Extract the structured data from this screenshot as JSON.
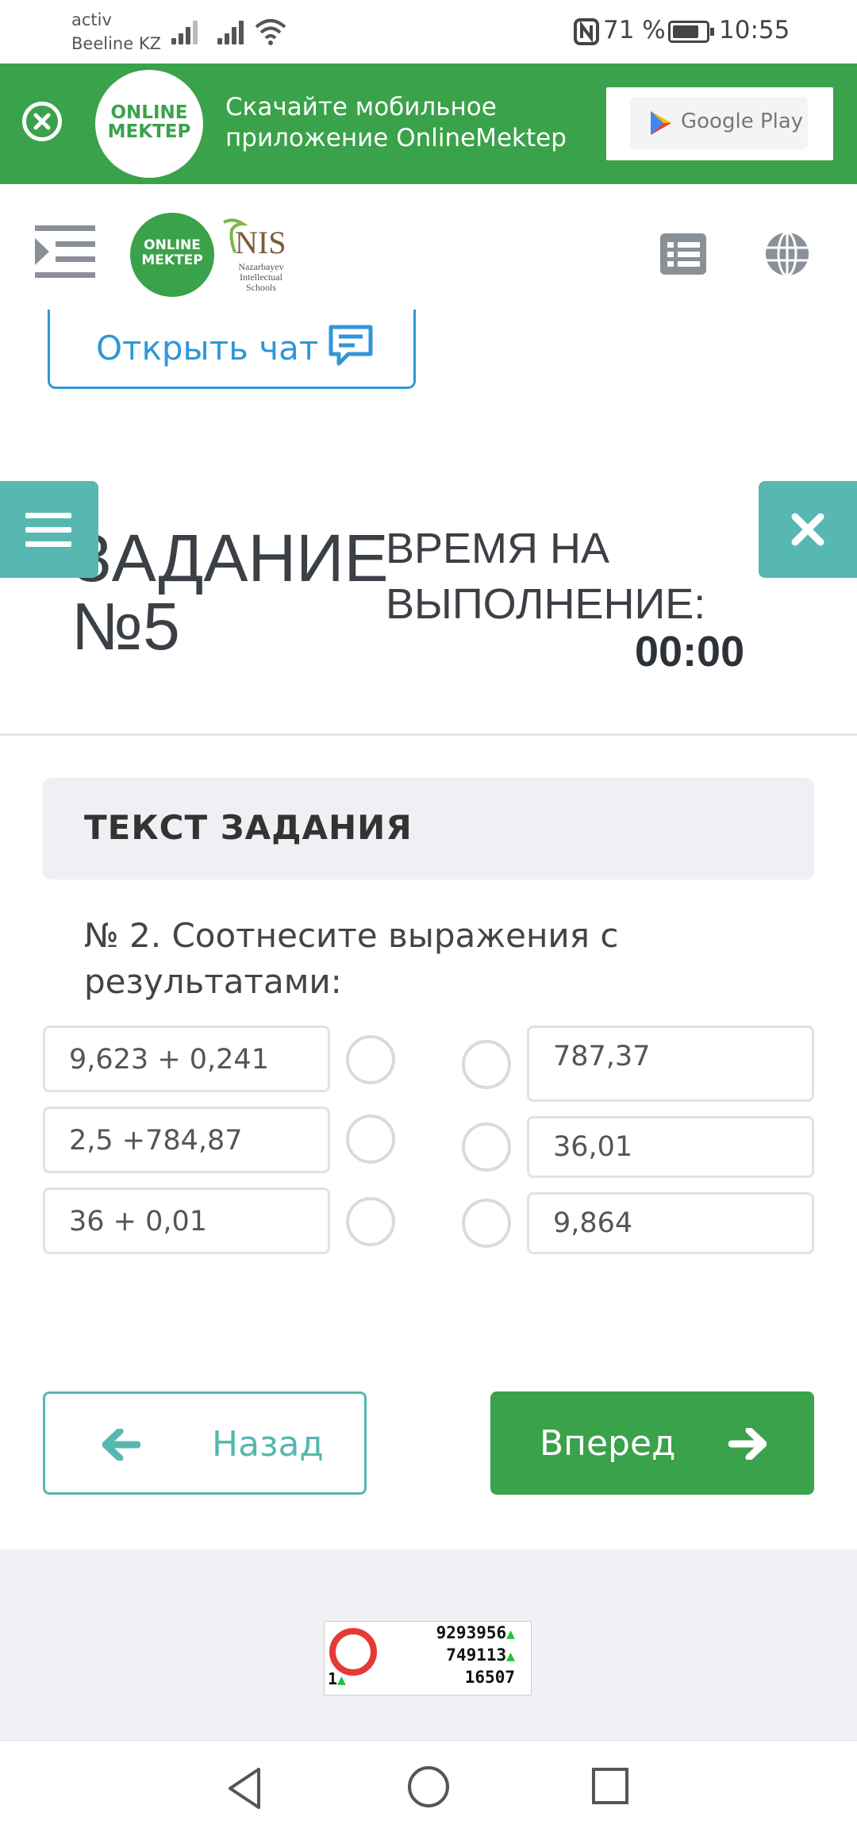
{
  "status_bar": {
    "carrier_line1": "activ",
    "carrier_line2": "Beeline KZ",
    "battery": "71 %",
    "time": "10:55"
  },
  "banner": {
    "logo_line1": "ONLINE",
    "logo_line2": "MEKTEP",
    "text_line1": "Скачайте мобильное",
    "text_line2": "приложение OnlineMektep",
    "store_label": "Google Play"
  },
  "header": {
    "logo_line1": "ONLINE",
    "logo_line2": "MEKTEP",
    "nis_title": "NIS",
    "nis_sub1": "Nazarbayev",
    "nis_sub2": "Intellectual",
    "nis_sub3": "Schools"
  },
  "chat_button": "Открыть чат",
  "task": {
    "title_line1": "ЗАДАНИЕ",
    "title_line2": "№5",
    "time_label_line1": "ВРЕМЯ НА",
    "time_label_line2": "ВЫПОЛНЕНИЕ:",
    "time_value": "00:00"
  },
  "task_text_header": "ТЕКСТ ЗАДАНИЯ",
  "question": "№ 2. Соотнесите выражения с результатами:",
  "left_items": [
    "9,623 + 0,241",
    "2,5 +784,87",
    "36 + 0,01"
  ],
  "right_items": [
    "787,37",
    "36,01",
    "9,864"
  ],
  "nav": {
    "back": "Назад",
    "next": "Вперед"
  },
  "counter": {
    "line1": "9293956",
    "line2": "749113",
    "line3": "16507",
    "left_num": "1"
  },
  "colors": {
    "brand_green": "#3aa24a",
    "teal": "#56b8b0",
    "link_blue": "#2f97d8"
  }
}
